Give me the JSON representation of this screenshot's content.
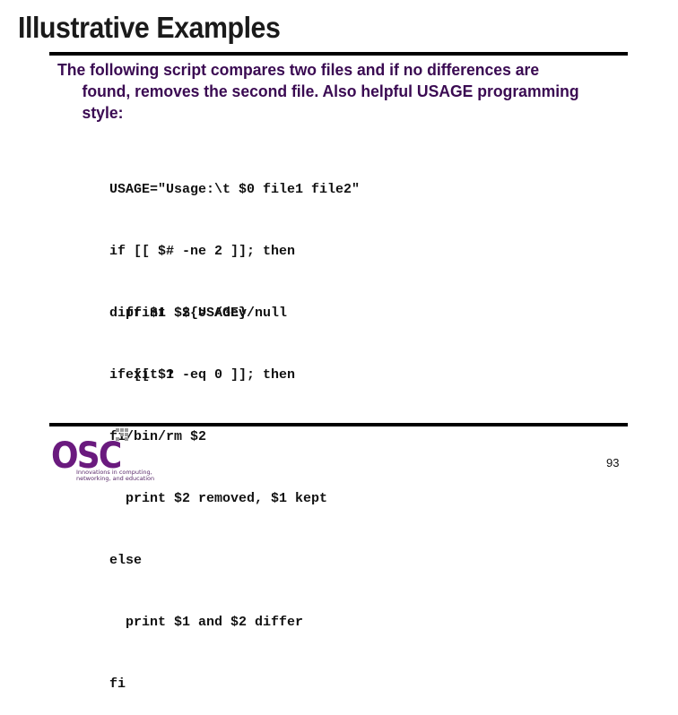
{
  "slide": {
    "title": "Illustrative Examples",
    "intro_first_line": "The following script compares two files and if no differences are",
    "intro_rest": "found, removes the second file. Also helpful USAGE programming style:",
    "code_block_1": [
      "USAGE=\"Usage:\\t $0 file1 file2\"",
      "if [[ $# -ne 2 ]]; then",
      "  print  ${USAGE}",
      "  exit 1",
      "fi"
    ],
    "code_block_2": [
      "diff $1 $2 > /dev/null",
      "if [[ $? -eq 0 ]]; then",
      "  /bin/rm $2",
      "  print $2 removed, $1 kept",
      "else",
      "  print $1 and $2 differ",
      "fi"
    ],
    "page_number": "93"
  },
  "logo": {
    "name": "OSC",
    "tagline_line1": "Innovations in computing,",
    "tagline_line2": "networking, and education",
    "brand_color": "#6a1a7e"
  }
}
